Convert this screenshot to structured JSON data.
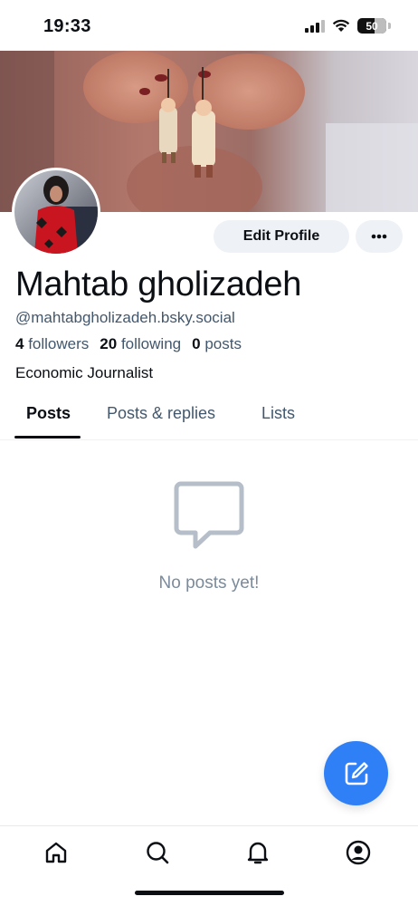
{
  "status_bar": {
    "time": "19:33",
    "battery_level": "50",
    "icons": [
      "signal-icon",
      "wifi-icon",
      "battery-icon"
    ]
  },
  "profile": {
    "display_name": "Mahtab gholizadeh",
    "handle": "@mahtabgholizadeh.bsky.social",
    "bio": "Economic Journalist",
    "edit_profile_label": "Edit Profile",
    "more_label": "•••",
    "stats": {
      "followers_count": "4",
      "followers_label": "followers",
      "following_count": "20",
      "following_label": "following",
      "posts_count": "0",
      "posts_label": "posts"
    }
  },
  "tabs": {
    "items": [
      {
        "label": "Posts",
        "active": true
      },
      {
        "label": "Posts & replies",
        "active": false
      },
      {
        "label": "Lists",
        "active": false
      }
    ]
  },
  "empty_state": {
    "text": "No posts yet!",
    "icon": "message-bubble-icon"
  },
  "bottom_nav": {
    "items": [
      "home-icon",
      "search-icon",
      "notifications-icon",
      "profile-icon"
    ]
  },
  "colors": {
    "accent": "#2f80f7",
    "text_primary": "#0b0f14",
    "text_secondary": "#42576c",
    "button_bg": "#eef1f5",
    "empty_icon": "#b6bfc9"
  }
}
